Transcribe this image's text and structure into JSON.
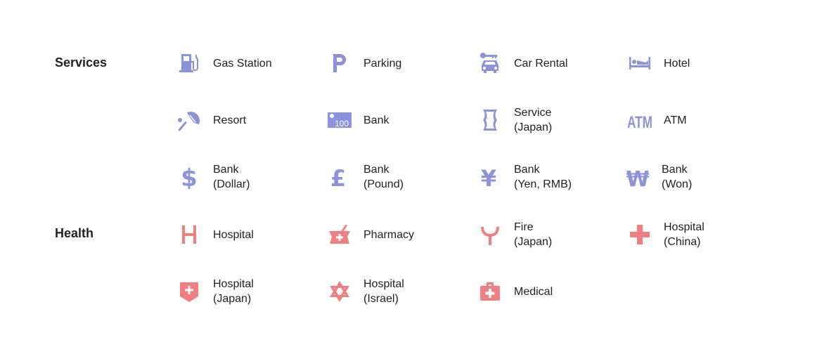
{
  "colors": {
    "services": "#8b93dc",
    "health": "#f07f80"
  },
  "categories": [
    {
      "title": "Services",
      "items": [
        {
          "icon": "gas-station-icon",
          "label": "Gas Station"
        },
        {
          "icon": "parking-icon",
          "label": "Parking"
        },
        {
          "icon": "car-rental-icon",
          "label": "Car Rental"
        },
        {
          "icon": "hotel-icon",
          "label": "Hotel"
        },
        {
          "icon": "resort-icon",
          "label": "Resort"
        },
        {
          "icon": "bank-icon",
          "label": "Bank"
        },
        {
          "icon": "service-japan-icon",
          "label": "Service\n(Japan)"
        },
        {
          "icon": "atm-icon",
          "label": "ATM"
        },
        {
          "icon": "dollar-icon",
          "label": "Bank\n(Dollar)"
        },
        {
          "icon": "pound-icon",
          "label": "Bank\n(Pound)"
        },
        {
          "icon": "yen-icon",
          "label": "Bank\n(Yen, RMB)"
        },
        {
          "icon": "won-icon",
          "label": "Bank\n(Won)"
        }
      ]
    },
    {
      "title": "Health",
      "items": [
        {
          "icon": "hospital-icon",
          "label": "Hospital"
        },
        {
          "icon": "pharmacy-icon",
          "label": "Pharmacy"
        },
        {
          "icon": "fire-japan-icon",
          "label": "Fire\n(Japan)"
        },
        {
          "icon": "hospital-china-icon",
          "label": "Hospital\n(China)"
        },
        {
          "icon": "hospital-japan-icon",
          "label": "Hospital\n(Japan)"
        },
        {
          "icon": "hospital-israel-icon",
          "label": "Hospital\n(Israel)"
        },
        {
          "icon": "medical-icon",
          "label": "Medical"
        }
      ]
    }
  ],
  "icon_text": {
    "atm": "ATM",
    "bank_note": "100",
    "dollar": "$",
    "pound": "£",
    "yen": "¥",
    "won": "₩"
  }
}
